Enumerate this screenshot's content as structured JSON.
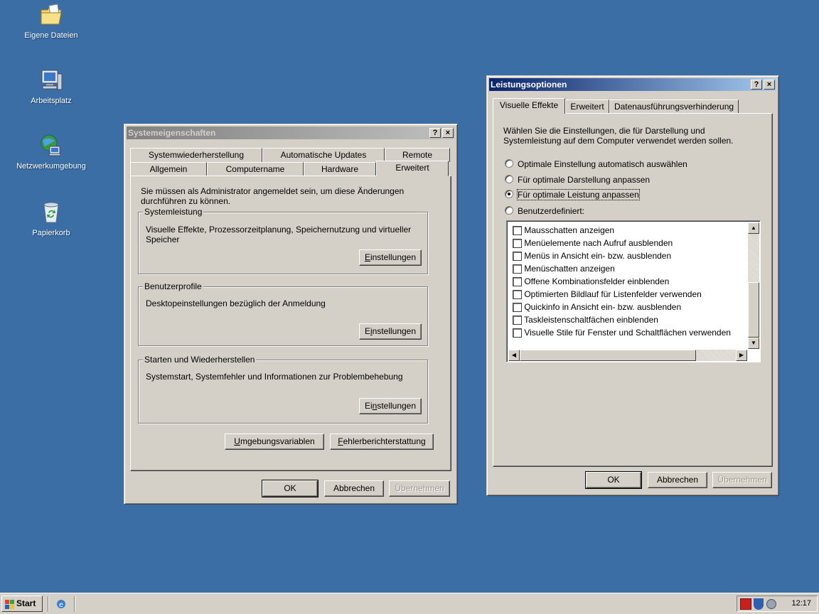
{
  "desktop": {
    "icons": [
      {
        "label": "Eigene Dateien",
        "icon": "folder-icon"
      },
      {
        "label": "Arbeitsplatz",
        "icon": "computer-icon"
      },
      {
        "label": "Netzwerkumgebung",
        "icon": "network-icon"
      },
      {
        "label": "Papierkorb",
        "icon": "recycle-bin-icon"
      }
    ]
  },
  "system_properties": {
    "title": "Systemeigenschaften",
    "help_btn": "?",
    "close_btn": "×",
    "tabs_row1": [
      "Systemwiederherstellung",
      "Automatische Updates",
      "Remote"
    ],
    "tabs_row2": [
      "Allgemein",
      "Computername",
      "Hardware",
      "Erweitert"
    ],
    "admin_note_line1": "Sie müssen als Administrator angemeldet sein, um diese Änderungen",
    "admin_note_line2": "durchführen zu können.",
    "groups": [
      {
        "title": "Systemleistung",
        "desc_line1": "Visuelle Effekte, Prozessorzeitplanung, Speichernutzung und virtueller",
        "desc_line2": "Speicher",
        "button": "Einstellungen"
      },
      {
        "title": "Benutzerprofile",
        "desc_line1": "Desktopeinstellungen bezüglich der Anmeldung",
        "desc_line2": "",
        "button": "Einstellungen"
      },
      {
        "title": "Starten und Wiederherstellen",
        "desc_line1": "Systemstart, Systemfehler und Informationen zur Problembehebung",
        "desc_line2": "",
        "button": "Einstellungen"
      }
    ],
    "env_button": "Umgebungsvariablen",
    "error_button": "Fehlerberichterstattung",
    "ok": "OK",
    "cancel": "Abbrechen",
    "apply": "Übernehmen"
  },
  "performance_options": {
    "title": "Leistungsoptionen",
    "help_btn": "?",
    "close_btn": "×",
    "tabs": [
      "Visuelle Effekte",
      "Erweitert",
      "Datenausführungsverhinderung"
    ],
    "intro_line1": "Wählen Sie die Einstellungen, die für Darstellung und",
    "intro_line2": "Systemleistung auf dem Computer verwendet werden sollen.",
    "radios": [
      {
        "label": "Optimale Einstellung automatisch auswählen",
        "checked": false
      },
      {
        "label": "Für optimale Darstellung anpassen",
        "checked": false
      },
      {
        "label": "Für optimale Leistung anpassen",
        "checked": true
      },
      {
        "label": "Benutzerdefiniert:",
        "checked": false
      }
    ],
    "checkboxes": [
      "Mausschatten anzeigen",
      "Menüelemente nach Aufruf ausblenden",
      "Menüs in Ansicht ein- bzw. ausblenden",
      "Menüschatten anzeigen",
      "Offene Kombinationsfelder einblenden",
      "Optimierten Bildlauf für Listenfelder verwenden",
      "Quickinfo in Ansicht ein- bzw. ausblenden",
      "Taskleistenschaltfächen einblenden",
      "Visuelle Stile für Fenster und Schaltflächen verwenden"
    ],
    "ok": "OK",
    "cancel": "Abbrechen",
    "apply": "Übernehmen"
  },
  "taskbar": {
    "start": "Start",
    "clock": "12:17"
  }
}
